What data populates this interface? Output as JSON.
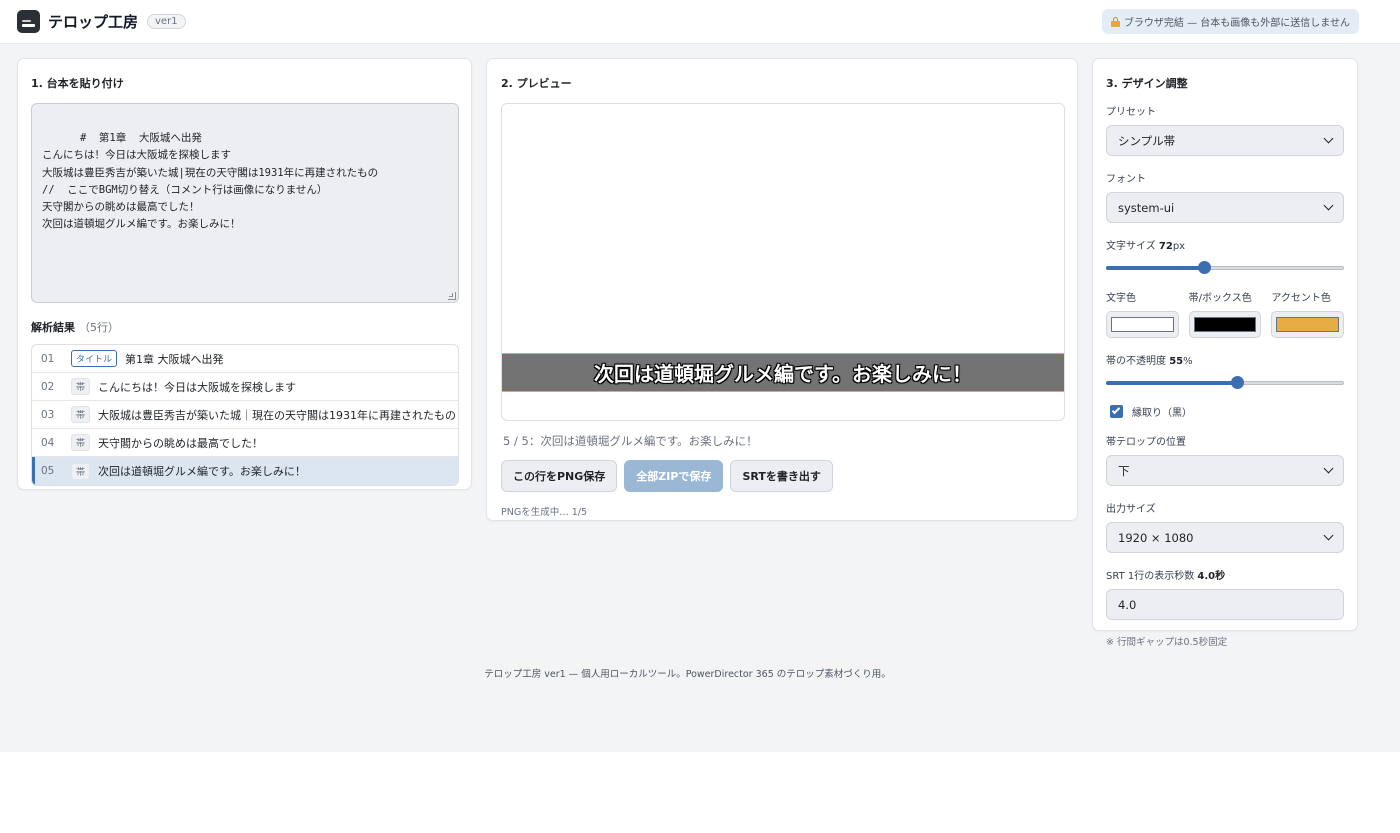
{
  "header": {
    "title": "テロップ工房",
    "version": "ver1",
    "privacy": "ブラウザ完結 — 台本も画像も外部に送信しません"
  },
  "script_panel": {
    "title": "1. 台本を貼り付け",
    "script_text": "#  第1章  大阪城へ出発\nこんにちは！今日は大阪城を探検します\n大阪城は豊臣秀吉が築いた城|現在の天守閣は1931年に再建されたもの\n//  ここでBGM切り替え（コメント行は画像になりません）\n天守閣からの眺めは最高でした！\n次回は道頓堀グルメ編です。お楽しみに！",
    "result_label": "解析結果",
    "result_count": "（5行）",
    "rows": [
      {
        "num": "01",
        "tag": "タイトル",
        "type": "title",
        "text": "第1章 大阪城へ出発"
      },
      {
        "num": "02",
        "tag": "帯",
        "type": "band",
        "text": "こんにちは！今日は大阪城を探検します"
      },
      {
        "num": "03",
        "tag": "帯",
        "type": "band",
        "text": "大阪城は豊臣秀吉が築いた城｜現在の天守閣は1931年に再建されたもの"
      },
      {
        "num": "04",
        "tag": "帯",
        "type": "band",
        "text": "天守閣からの眺めは最高でした！"
      },
      {
        "num": "05",
        "tag": "帯",
        "type": "band",
        "text": "次回は道頓堀グルメ編です。お楽しみに！"
      }
    ],
    "selected_index": 4
  },
  "preview_panel": {
    "title": "2. プレビュー",
    "band_text": "次回は道頓堀グルメ編です。お楽しみに！",
    "caption": "5 / 5：次回は道頓堀グルメ編です。お楽しみに！",
    "save_png_label": "この行をPNG保存",
    "save_zip_label": "全部ZIPで保存",
    "export_srt_label": "SRTを書き出す",
    "status": "PNGを生成中… 1/5"
  },
  "design_panel": {
    "title": "3. デザイン調整",
    "preset_label": "プリセット",
    "preset_value": "シンプル帯",
    "font_label": "フォント",
    "font_value": "system-ui",
    "size_label": "文字サイズ",
    "size_value": "72",
    "size_unit": "px",
    "size_fraction": 0.41,
    "text_color_label": "文字色",
    "box_color_label": "帯/ボックス色",
    "accent_color_label": "アクセント色",
    "colors": {
      "text": "#ffffff",
      "box": "#000000",
      "accent": "#e8ac45"
    },
    "opacity_label": "帯の不透明度",
    "opacity_value": "55",
    "opacity_unit": "%",
    "opacity_fraction": 0.55,
    "outline_label": "縁取り（黒）",
    "position_label": "帯テロップの位置",
    "position_value": "下",
    "output_label": "出力サイズ",
    "output_value": "1920 × 1080",
    "srt_label": "SRT 1行の表示秒数",
    "srt_value_display": "4.0秒",
    "srt_input_value": "4.0",
    "note": "※ 行間ギャップは0.5秒固定"
  },
  "footer": {
    "text": "テロップ工房 ver1 — 個人用ローカルツール。PowerDirector 365 のテロップ素材づくり用。"
  }
}
